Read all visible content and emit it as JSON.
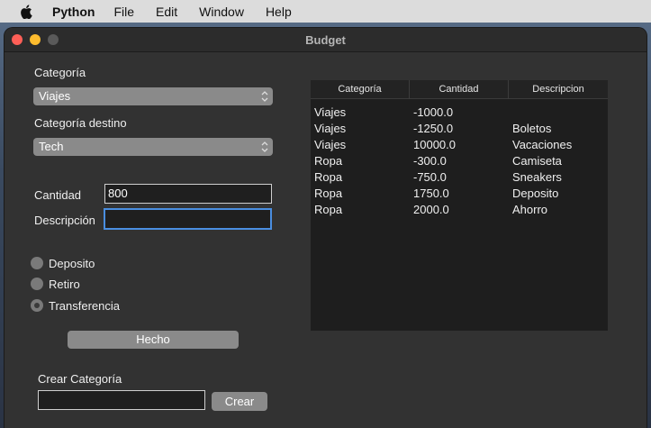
{
  "menubar": {
    "app_name": "Python",
    "menus": [
      "File",
      "Edit",
      "Window",
      "Help"
    ]
  },
  "window": {
    "title": "Budget"
  },
  "form": {
    "category_label": "Categoría",
    "category_value": "Viajes",
    "dest_category_label": "Categoría destino",
    "dest_category_value": "Tech",
    "amount_label": "Cantidad",
    "amount_value": "800",
    "description_label": "Descripción",
    "description_value": "",
    "radio": {
      "deposit": "Deposito",
      "withdraw": "Retiro",
      "transfer": "Transferencia",
      "selected": "transfer"
    },
    "done_button": "Hecho",
    "create_category_label": "Crear Categoría",
    "create_category_value": "",
    "create_button": "Crear"
  },
  "table": {
    "headers": [
      "Categoría",
      "Cantidad",
      "Descripcion"
    ],
    "rows": [
      [
        "Viajes",
        "-1000.0",
        ""
      ],
      [
        "Viajes",
        "-1250.0",
        "Boletos"
      ],
      [
        "Viajes",
        "10000.0",
        "Vacaciones"
      ],
      [
        "Ropa",
        "-300.0",
        "Camiseta"
      ],
      [
        "Ropa",
        "-750.0",
        "Sneakers"
      ],
      [
        "Ropa",
        "1750.0",
        "Deposito"
      ],
      [
        "Ropa",
        "2000.0",
        "Ahorro"
      ]
    ]
  },
  "colors": {
    "accent_focus": "#4a8ee0",
    "close": "#fe5f57",
    "minimize": "#febc2e",
    "window_bg": "#323232"
  }
}
